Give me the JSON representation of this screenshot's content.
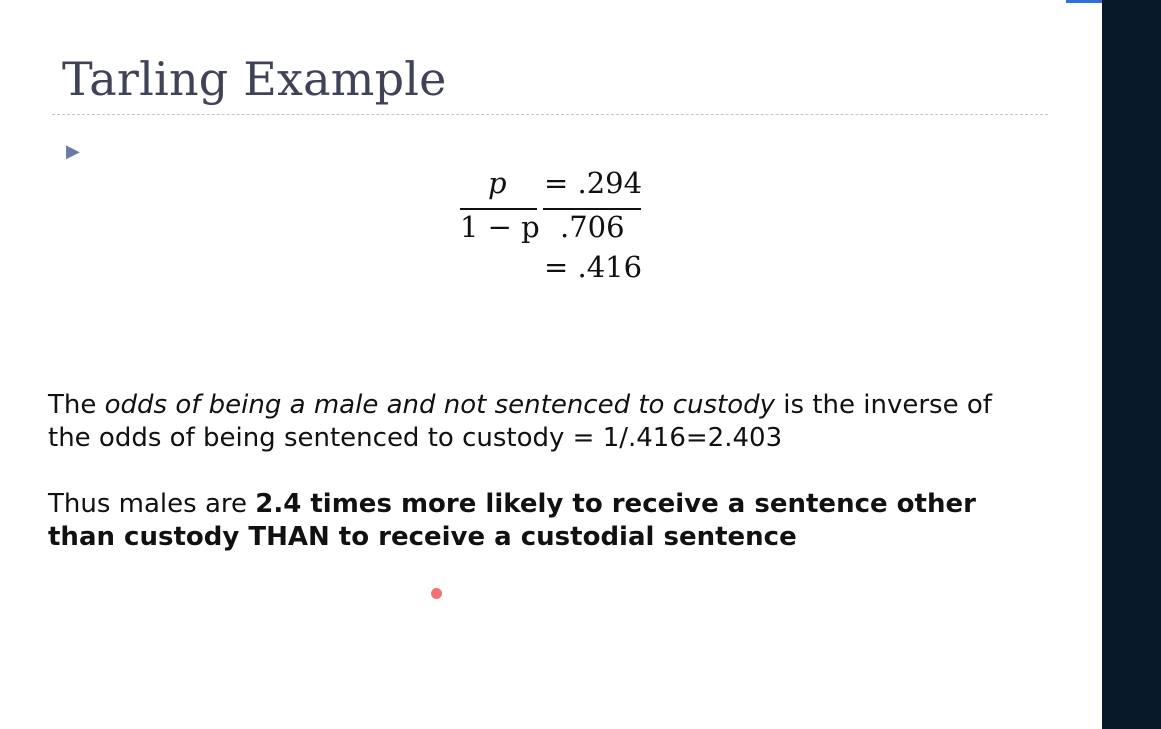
{
  "slide": {
    "title": "Tarling Example",
    "bullet_icon": "triangle-right-bullet-icon",
    "equation": {
      "numerator_symbol": "p",
      "denominator": "1 − p",
      "eq1": "= .294",
      "den_value": ".706",
      "eq2": "= .416"
    },
    "paragraph1": {
      "line1_prefix": "The ",
      "line1_italic": "odds of being a male and not sentenced to custody",
      "line1_suffix": " is the inverse of",
      "line2": "the odds of being sentenced to custody = 1/.416=2.403"
    },
    "paragraph2": {
      "line1_prefix": "Thus males are ",
      "line1_bold": "2.4 times more likely to receive a sentence other",
      "line2_bold": "than custody THAN to receive a custodial sentence"
    }
  },
  "colors": {
    "title": "#404258",
    "bullet": "#6b7aa6",
    "right_panel": "#08192a",
    "rule": "#b9c9d4",
    "pointer_dot": "#f47276",
    "corner_mark": "#2f6fd8"
  }
}
